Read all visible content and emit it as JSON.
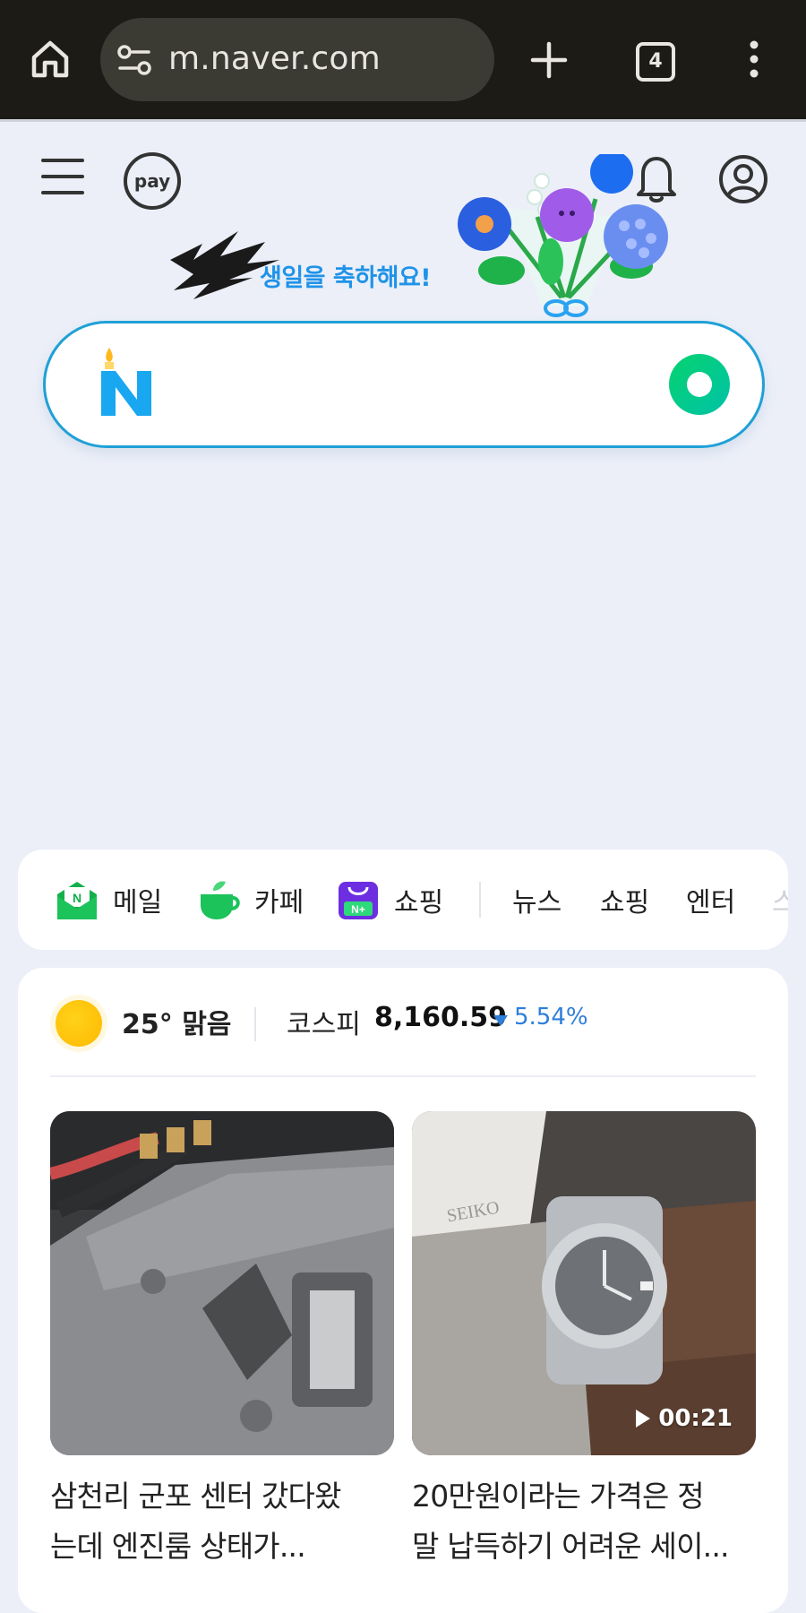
{
  "browser": {
    "url": "m.naver.com",
    "tab_count": "4",
    "icons": [
      "home-icon",
      "site-settings-icon",
      "new-tab-icon",
      "tab-switcher-icon",
      "menu-icon"
    ]
  },
  "header": {
    "pay_label": "pay",
    "birthday_text": "생일을 축하해요!",
    "icons": [
      "hamburger-icon",
      "bell-icon",
      "profile-icon"
    ]
  },
  "search": {
    "logo": "N",
    "accent": "#1fa0d6",
    "button_color": "#06d36e"
  },
  "shortcuts": {
    "apps": [
      {
        "label": "메일",
        "icon": "mail-icon"
      },
      {
        "label": "카페",
        "icon": "cafe-icon"
      },
      {
        "label": "쇼핑",
        "icon": "shopping-icon"
      }
    ],
    "tabs": [
      "뉴스",
      "쇼핑",
      "엔터",
      "스"
    ]
  },
  "info_bar": {
    "weather": "25° 맑음",
    "kospi_label": "코스피",
    "kospi_value": "8,160.59",
    "kospi_change": "5.54%",
    "change_color": "#2e7fd9"
  },
  "feed": [
    {
      "caption_line1": "삼천리 군포 센터 갔다왔",
      "caption_line2": "는데 엔진룸 상태가..."
    },
    {
      "caption_line1": "20만원이라는 가격은 정",
      "caption_line2": "말 납득하기 어려운 세이...",
      "video_duration": "00:21"
    }
  ]
}
